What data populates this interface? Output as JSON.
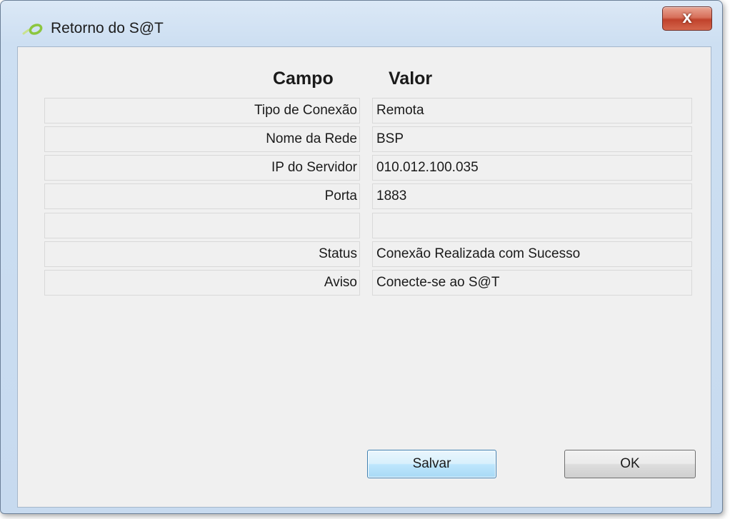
{
  "window": {
    "title": "Retorno do S@T",
    "close_label": "x"
  },
  "table": {
    "header_field": "Campo",
    "header_value": "Valor",
    "rows": [
      {
        "field": "Tipo de Conexão",
        "value": "Remota"
      },
      {
        "field": "Nome da Rede",
        "value": "BSP"
      },
      {
        "field": "IP do Servidor",
        "value": "010.012.100.035"
      },
      {
        "field": "Porta",
        "value": "1883"
      },
      {
        "field": "",
        "value": ""
      },
      {
        "field": "Status",
        "value": "Conexão Realizada com Sucesso"
      },
      {
        "field": "Aviso",
        "value": "Conecte-se ao S@T"
      }
    ]
  },
  "buttons": {
    "save_label": "Salvar",
    "ok_label": "OK"
  },
  "colors": {
    "close_button": "#c7432b",
    "app_icon": "#8cc63f",
    "default_button_border": "#3c7fb1"
  },
  "icons": {
    "app": "sat-logo-icon",
    "close": "close-icon"
  }
}
